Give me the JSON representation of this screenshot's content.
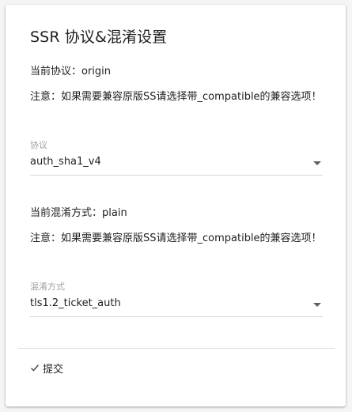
{
  "card": {
    "title": "SSR 协议&混淆设置"
  },
  "protocol": {
    "current_label": "当前协议：origin",
    "note": "注意：如果需要兼容原版SS请选择带_compatible的兼容选项！",
    "field_label": "协议",
    "selected": "auth_sha1_v4"
  },
  "obfs": {
    "current_label": "当前混淆方式：plain",
    "note": "注意：如果需要兼容原版SS请选择带_compatible的兼容选项！",
    "field_label": "混淆方式",
    "selected": "tls1.2_ticket_auth"
  },
  "actions": {
    "submit_label": "提交",
    "submit_icon": "check-icon"
  }
}
